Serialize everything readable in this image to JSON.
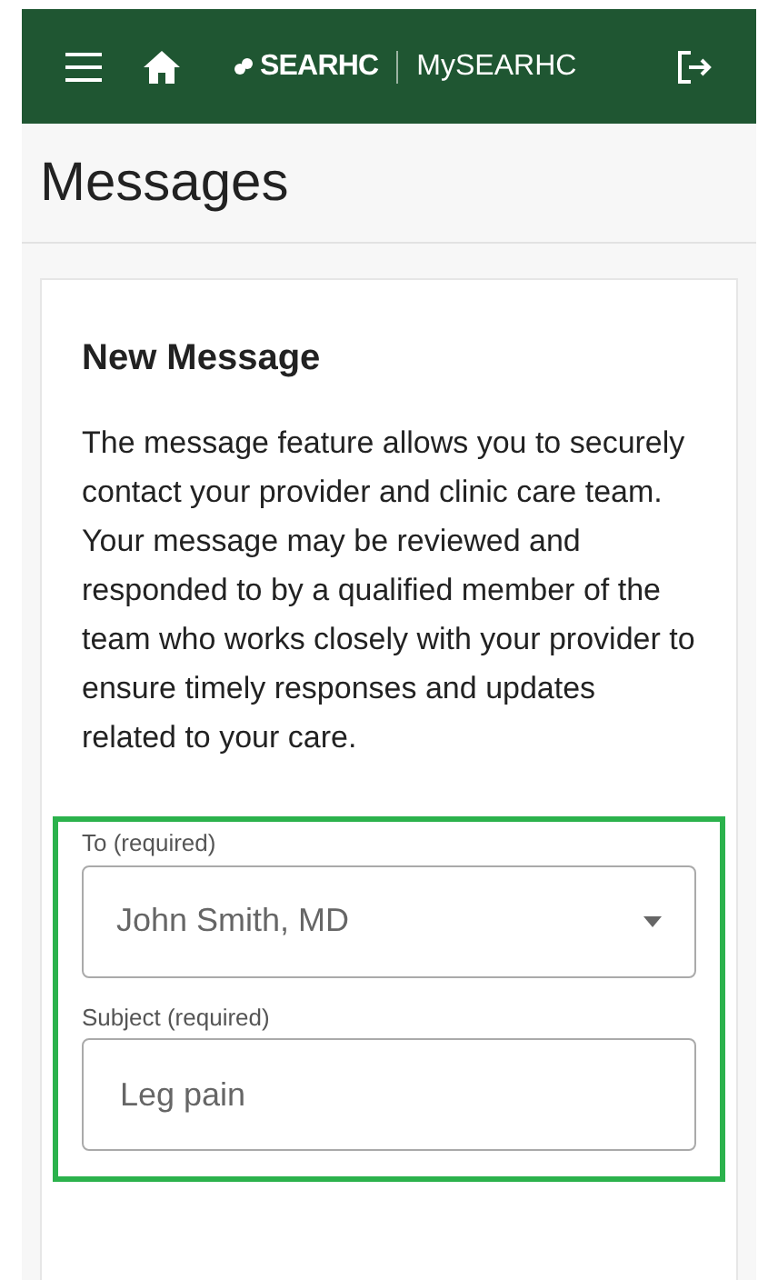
{
  "header": {
    "brand": "SEARHC",
    "app_name": "MySEARHC"
  },
  "page": {
    "title": "Messages"
  },
  "card": {
    "title": "New Message",
    "description": "The message feature allows you to securely contact your provider and clinic care team. Your message may be reviewed and responded to by a qualified member of the team who works closely with your provider to ensure timely responses and updates related to your care."
  },
  "fields": [
    {
      "kind": "select",
      "label": "To (required)",
      "value": "John Smith, MD"
    },
    {
      "kind": "text",
      "label": "Subject (required)",
      "value": "Leg pain"
    }
  ]
}
